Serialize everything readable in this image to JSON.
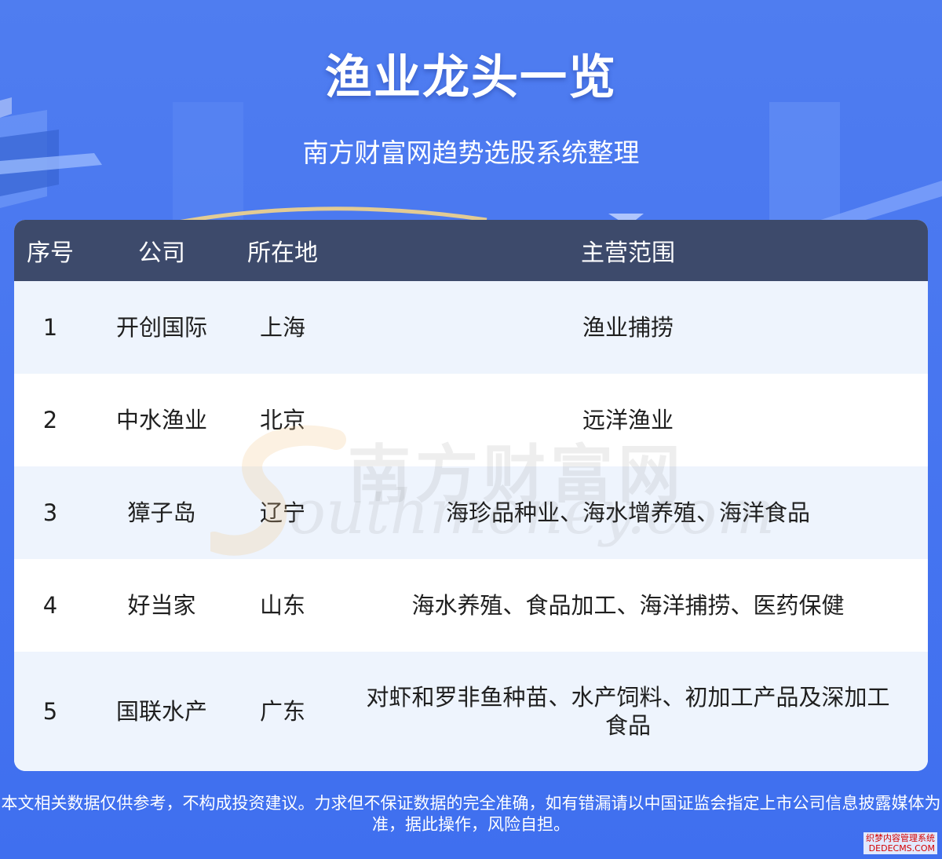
{
  "header": {
    "title": "渔业龙头一览",
    "subtitle": "南方财富网趋势选股系统整理"
  },
  "table": {
    "columns": [
      "序号",
      "公司",
      "所在地",
      "主营范围"
    ],
    "rows": [
      {
        "index": "1",
        "company": "开创国际",
        "location": "上海",
        "business": "渔业捕捞"
      },
      {
        "index": "2",
        "company": "中水渔业",
        "location": "北京",
        "business": "远洋渔业"
      },
      {
        "index": "3",
        "company": "獐子岛",
        "location": "辽宁",
        "business": "海珍品种业、海水增养殖、海洋食品"
      },
      {
        "index": "4",
        "company": "好当家",
        "location": "山东",
        "business": "海水养殖、食品加工、海洋捕捞、医药保健"
      },
      {
        "index": "5",
        "company": "国联水产",
        "location": "广东",
        "business": "对虾和罗非鱼种苗、水产饲料、初加工产品及深加工食品"
      }
    ]
  },
  "watermark": {
    "cn": "南方财富网",
    "en": "outhmoney.com"
  },
  "footer": {
    "disclaimer": "本文相关数据仅供参考，不构成投资建议。力求但不保证数据的完全准确，如有错漏请以中国证监会指定上市公司信息披露媒体为准，据此操作，风险自担。",
    "corner_cn": "织梦内容管理系统",
    "corner_en": "DEDECMS.COM"
  }
}
